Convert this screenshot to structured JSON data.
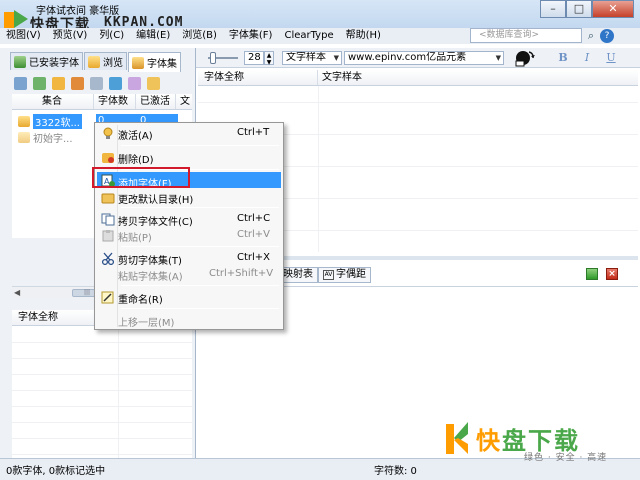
{
  "title_bar": {
    "title": "字体试衣间 豪华版",
    "watermark_text": "快盘下载",
    "watermark_url": "KKPAN.COM",
    "minimize": "–",
    "maximize": "□",
    "close": "✕"
  },
  "menu": {
    "items": [
      "视图(V)",
      "预览(V)",
      "列(C)",
      "编辑(E)",
      "浏览(B)",
      "字体集(F)",
      "ClearType",
      "帮助(H)"
    ],
    "search_placeholder": "<数据库查询>",
    "help_glyph": "?"
  },
  "left_panel": {
    "tabs": [
      {
        "label": "已安装字体",
        "icon": "installed-fonts-icon"
      },
      {
        "label": "浏览",
        "icon": "browse-folder-icon"
      },
      {
        "label": "字体集",
        "icon": "font-set-icon"
      }
    ],
    "tree_columns": [
      "集合",
      "字体数",
      "已激活",
      "文"
    ],
    "tree_rows": [
      {
        "label": "3322软...",
        "count": "0",
        "active": "0"
      },
      {
        "label": "初始字...",
        "count": "",
        "active": ""
      }
    ],
    "font_list_header": "字体全称"
  },
  "right_toolbar": {
    "font_size": "28",
    "sample_type": "文字样本",
    "sample_text": "www.epinv.com亿品元素",
    "bold": "B",
    "italic": "I",
    "underline": "U"
  },
  "preview_columns": [
    "字体全称",
    "文字样本"
  ],
  "bottom_tabs": [
    "映射表",
    "字偶距"
  ],
  "context_menu": {
    "items": [
      {
        "label": "激活(A)",
        "shortcut": "Ctrl+T",
        "disabled": false,
        "icon": "activate-icon"
      },
      {
        "label": "删除(D)",
        "shortcut": "",
        "disabled": false,
        "icon": "delete-icon"
      },
      {
        "label": "添加字体(F)",
        "shortcut": "",
        "disabled": false,
        "icon": "add-font-icon"
      },
      {
        "label": "更改默认目录(H)",
        "shortcut": "",
        "disabled": false,
        "icon": "change-folder-icon"
      },
      {
        "label": "拷贝字体文件(C)",
        "shortcut": "Ctrl+C",
        "disabled": false,
        "icon": "copy-icon"
      },
      {
        "label": "粘贴(P)",
        "shortcut": "Ctrl+V",
        "disabled": true,
        "icon": "paste-icon"
      },
      {
        "label": "剪切字体集(T)",
        "shortcut": "Ctrl+X",
        "disabled": false,
        "icon": "cut-icon"
      },
      {
        "label": "粘贴字体集(A)",
        "shortcut": "Ctrl+Shift+V",
        "disabled": true,
        "icon": "paste-set-icon"
      },
      {
        "label": "重命名(R)",
        "shortcut": "",
        "disabled": false,
        "icon": "rename-icon"
      },
      {
        "label": "上移一层(M)",
        "shortcut": "",
        "disabled": true,
        "icon": ""
      }
    ]
  },
  "status": {
    "left": "0款字体, 0款标记选中",
    "right": "字符数: 0"
  },
  "brand": {
    "name_a": "快",
    "name_b": "盘下载",
    "slogan": "绿色 · 安全 · 高速"
  },
  "colors": {
    "selection": "#3399ff",
    "highlight_frame": "#d3192c",
    "brand_orange": "#ff9c00",
    "brand_green": "#4aa84a"
  }
}
